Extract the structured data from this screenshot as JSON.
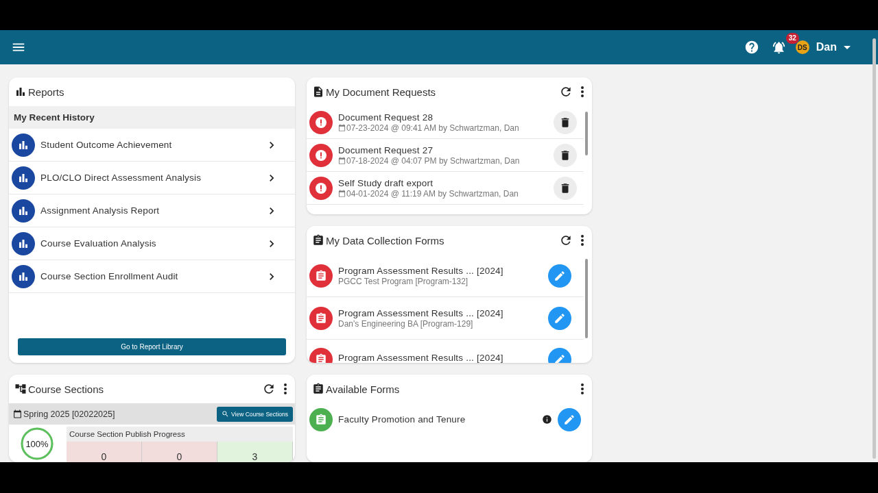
{
  "header": {
    "notification_count": "32",
    "user_initials": "DS",
    "user_name": "Dan"
  },
  "reports": {
    "title": "Reports",
    "section": "My Recent History",
    "items": [
      {
        "label": "Student Outcome Achievement"
      },
      {
        "label": "PLO/CLO Direct Assessment Analysis"
      },
      {
        "label": "Assignment Analysis Report"
      },
      {
        "label": "Course Evaluation Analysis"
      },
      {
        "label": "Course Section Enrollment Audit"
      }
    ],
    "button": "Go to Report Library"
  },
  "document_requests": {
    "title": "My Document Requests",
    "items": [
      {
        "title": "Document Request 28",
        "meta": "07-23-2024 @ 09:41 AM by Schwartzman, Dan"
      },
      {
        "title": "Document Request 27",
        "meta": "07-18-2024 @ 04:07 PM by Schwartzman, Dan"
      },
      {
        "title": "Self Study draft export",
        "meta": "04-01-2024 @ 11:19 AM by Schwartzman, Dan"
      }
    ]
  },
  "data_collection_forms": {
    "title": "My Data Collection Forms",
    "items": [
      {
        "title": "Program Assessment Results ... [2024]",
        "subtitle": "PGCC Test Program [Program-132]"
      },
      {
        "title": "Program Assessment Results ... [2024]",
        "subtitle": "Dan's Engineering BA [Program-129]"
      },
      {
        "title": "Program Assessment Results ... [2024]"
      }
    ]
  },
  "course_sections": {
    "title": "Course Sections",
    "term": "Spring 2025 [02022025]",
    "button": "View Course Sections",
    "percent": "100%",
    "level": 1,
    "progress_title": "Course Section Publish Progress",
    "segments": [
      {
        "value": "0",
        "color": "#f2dcdc"
      },
      {
        "value": "0",
        "color": "#f2dcdc"
      },
      {
        "value": "3",
        "color": "#e1f3dc"
      }
    ]
  },
  "available_forms": {
    "title": "Available Forms",
    "items": [
      {
        "title": "Faculty Promotion and Tenure"
      }
    ]
  }
}
